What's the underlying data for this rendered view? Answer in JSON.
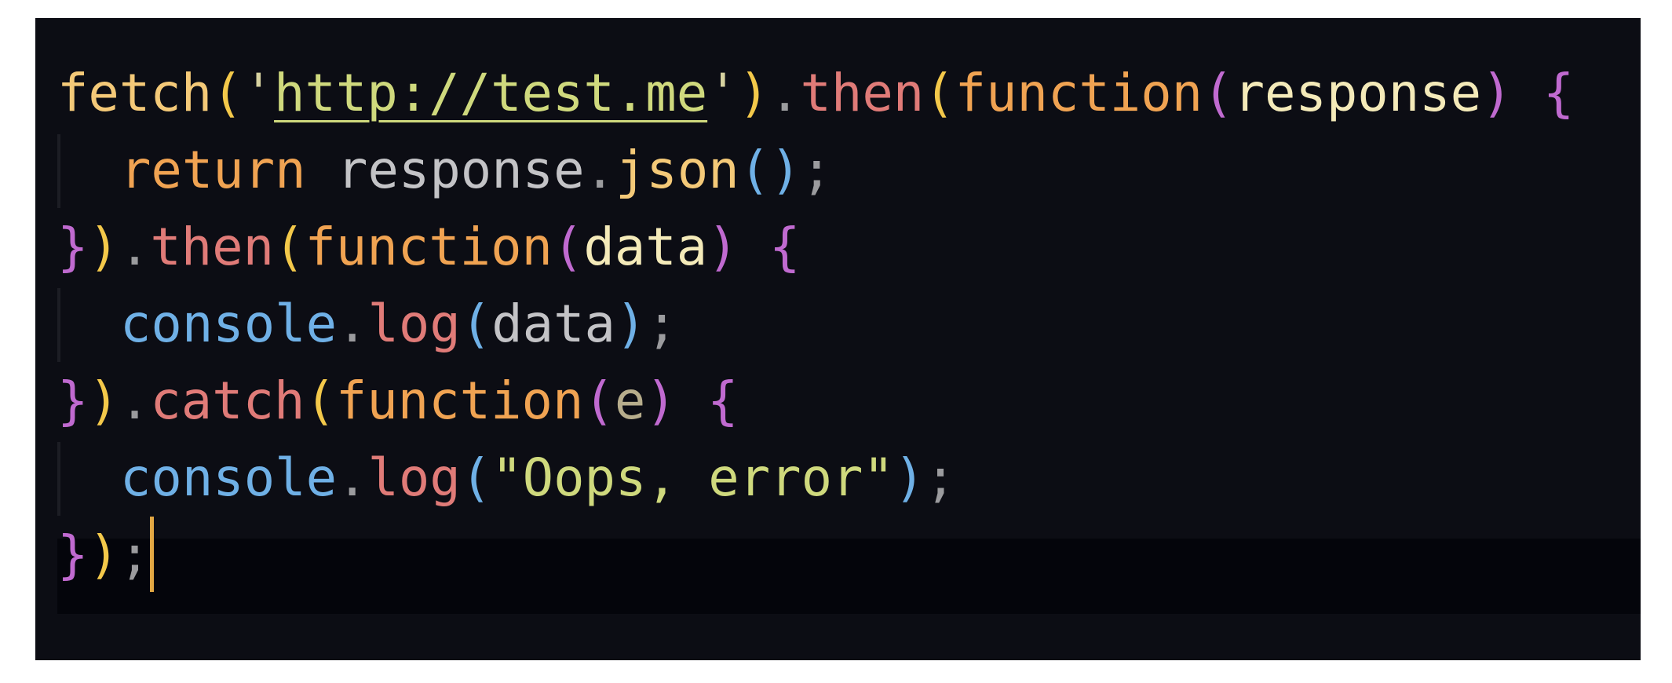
{
  "editor": {
    "lines": [
      {
        "indent": false,
        "tokens": [
          {
            "text": "fetch",
            "role": "function-name"
          },
          {
            "text": "(",
            "role": "paren-1"
          },
          {
            "text": "'",
            "role": "string"
          },
          {
            "text": "http://test.me",
            "role": "url"
          },
          {
            "text": "'",
            "role": "string"
          },
          {
            "text": ")",
            "role": "paren-1"
          },
          {
            "text": ".",
            "role": "punct"
          },
          {
            "text": "then",
            "role": "method"
          },
          {
            "text": "(",
            "role": "paren-1"
          },
          {
            "text": "function",
            "role": "keyword"
          },
          {
            "text": "(",
            "role": "paren-2"
          },
          {
            "text": "response",
            "role": "param"
          },
          {
            "text": ")",
            "role": "paren-2"
          },
          {
            "text": " ",
            "role": "space"
          },
          {
            "text": "{",
            "role": "brace"
          }
        ]
      },
      {
        "indent": true,
        "tokens": [
          {
            "text": "return",
            "role": "keyword"
          },
          {
            "text": " ",
            "role": "space"
          },
          {
            "text": "response",
            "role": "variable"
          },
          {
            "text": ".",
            "role": "punct"
          },
          {
            "text": "json",
            "role": "function-name"
          },
          {
            "text": "()",
            "role": "paren-3"
          },
          {
            "text": ";",
            "role": "punct"
          }
        ]
      },
      {
        "indent": false,
        "tokens": [
          {
            "text": "}",
            "role": "brace"
          },
          {
            "text": ")",
            "role": "paren-1"
          },
          {
            "text": ".",
            "role": "punct"
          },
          {
            "text": "then",
            "role": "method"
          },
          {
            "text": "(",
            "role": "paren-1"
          },
          {
            "text": "function",
            "role": "keyword"
          },
          {
            "text": "(",
            "role": "paren-2"
          },
          {
            "text": "data",
            "role": "param"
          },
          {
            "text": ")",
            "role": "paren-2"
          },
          {
            "text": " ",
            "role": "space"
          },
          {
            "text": "{",
            "role": "brace"
          }
        ]
      },
      {
        "indent": true,
        "tokens": [
          {
            "text": "console",
            "role": "object"
          },
          {
            "text": ".",
            "role": "punct"
          },
          {
            "text": "log",
            "role": "method"
          },
          {
            "text": "(",
            "role": "paren-3"
          },
          {
            "text": "data",
            "role": "variable"
          },
          {
            "text": ")",
            "role": "paren-3"
          },
          {
            "text": ";",
            "role": "punct"
          }
        ]
      },
      {
        "indent": false,
        "tokens": [
          {
            "text": "}",
            "role": "brace"
          },
          {
            "text": ")",
            "role": "paren-1"
          },
          {
            "text": ".",
            "role": "punct"
          },
          {
            "text": "catch",
            "role": "method"
          },
          {
            "text": "(",
            "role": "paren-1"
          },
          {
            "text": "function",
            "role": "keyword"
          },
          {
            "text": "(",
            "role": "paren-2"
          },
          {
            "text": "e",
            "role": "param-dim"
          },
          {
            "text": ")",
            "role": "paren-2"
          },
          {
            "text": " ",
            "role": "space"
          },
          {
            "text": "{",
            "role": "brace"
          }
        ]
      },
      {
        "indent": true,
        "tokens": [
          {
            "text": "console",
            "role": "object"
          },
          {
            "text": ".",
            "role": "punct"
          },
          {
            "text": "log",
            "role": "method"
          },
          {
            "text": "(",
            "role": "paren-3"
          },
          {
            "text": "\"Oops, error\"",
            "role": "string-literal"
          },
          {
            "text": ")",
            "role": "paren-3"
          },
          {
            "text": ";",
            "role": "punct"
          }
        ]
      },
      {
        "indent": false,
        "current": true,
        "tokens": [
          {
            "text": "}",
            "role": "brace"
          },
          {
            "text": ")",
            "role": "paren-1"
          },
          {
            "text": ";",
            "role": "punct"
          }
        ]
      }
    ]
  },
  "colors": {
    "function-name": "#f4c978",
    "paren-1": "#f3c84a",
    "paren-2": "#c06ad0",
    "paren-3": "#6fb0e6",
    "string": "#d7d2a0",
    "url": "#cfd97d",
    "punct": "#9b9b9e",
    "method": "#e07b78",
    "keyword": "#f0a352",
    "param": "#f4eab9",
    "param-dim": "#b7ad8c",
    "brace": "#c06ad0",
    "variable": "#c3c3c6",
    "object": "#6fb0e6",
    "string-literal": "#cfd97d",
    "space": "#ffffff",
    "editor-background": "#0c0d14",
    "current-line": "#04050b",
    "cursor": "#e2a743"
  }
}
